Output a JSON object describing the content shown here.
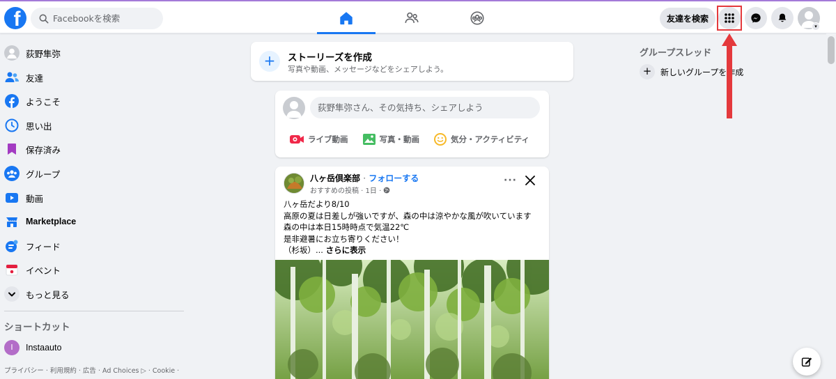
{
  "topbar": {
    "logo_icon": "facebook-logo-icon",
    "search_placeholder": "Facebookを検索",
    "nav_tabs": [
      {
        "name": "home",
        "icon": "home-icon",
        "active": true
      },
      {
        "name": "friends",
        "icon": "friends-icon",
        "active": false
      },
      {
        "name": "groups",
        "icon": "groups-icon",
        "active": false
      }
    ],
    "find_friends_label": "友達を検索",
    "menu_icon": "grid-menu-icon",
    "messenger_icon": "messenger-icon",
    "notifications_icon": "bell-icon",
    "accent_color": "#1877f2"
  },
  "sidebar": {
    "items": [
      {
        "label": "荻野隼弥",
        "icon": "profile-avatar-icon"
      },
      {
        "label": "友達",
        "icon": "friends-icon"
      },
      {
        "label": "ようこそ",
        "icon": "facebook-icon"
      },
      {
        "label": "思い出",
        "icon": "memories-clock-icon"
      },
      {
        "label": "保存済み",
        "icon": "bookmark-icon"
      },
      {
        "label": "グループ",
        "icon": "groups-icon"
      },
      {
        "label": "動画",
        "icon": "video-icon"
      },
      {
        "label": "Marketplace",
        "icon": "marketplace-icon"
      },
      {
        "label": "フィード",
        "icon": "feed-icon"
      },
      {
        "label": "イベント",
        "icon": "calendar-icon"
      },
      {
        "label": "もっと見る",
        "icon": "chevron-down-icon"
      }
    ],
    "shortcuts_title": "ショートカット",
    "shortcuts": [
      {
        "label": "Instaauto",
        "initial": "I"
      }
    ],
    "footer_text": "プライバシー · 利用規約 · 広告 · Ad Choices ▷ · Cookie ·"
  },
  "feed": {
    "story": {
      "title": "ストーリーズを作成",
      "subtitle": "写真や動画、メッセージなどをシェアしよう。"
    },
    "composer": {
      "placeholder": "荻野隼弥さん、その気持ち、シェアしよう",
      "actions": [
        {
          "label": "ライブ動画",
          "icon": "live-video-icon",
          "color": "#f02849"
        },
        {
          "label": "写真・動画",
          "icon": "photo-icon",
          "color": "#45bd62"
        },
        {
          "label": "気分・アクティビティ",
          "icon": "smiley-icon",
          "color": "#f7b928"
        }
      ]
    },
    "post": {
      "author": "八ヶ岳倶楽部",
      "separator": "·",
      "follow_label": "フォローする",
      "meta": "おすすめの投稿 · 1日 ·",
      "more_label": "···",
      "lines": [
        "八ヶ岳だより8/10",
        "高原の夏は日差しが強いですが、森の中は涼やかな風が吹いています",
        "森の中は本日15時時点で気温22℃",
        "是非避暑にお立ち寄りください！"
      ],
      "last_line_prefix": "（杉坂）...",
      "see_more_label": "さらに表示"
    }
  },
  "right": {
    "title": "グループスレッド",
    "new_group_label": "新しいグループを作成"
  },
  "annotation": {
    "color": "#e4393c"
  }
}
